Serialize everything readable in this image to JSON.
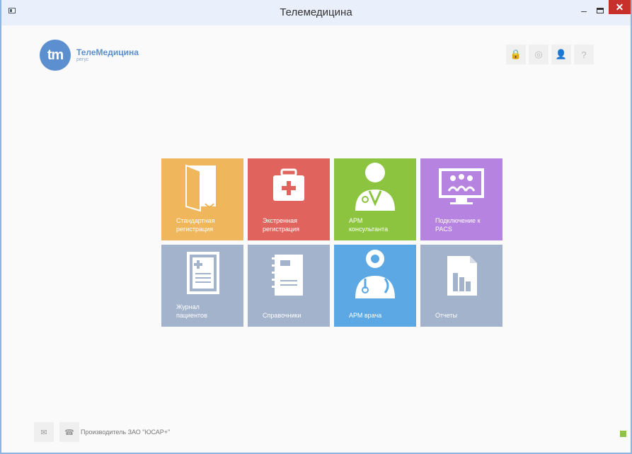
{
  "window": {
    "title": "Телемедицина",
    "controls": {
      "minimize": "–",
      "close": "✕"
    }
  },
  "logo": {
    "badge": "tm",
    "name": "ТелеМедицина",
    "subtitle": "регус"
  },
  "top_icons": [
    "lock-icon",
    "settings-icon",
    "user-icon",
    "help-icon"
  ],
  "top_icon_glyphs": {
    "lock": "🔒",
    "settings": "◎",
    "user": "👤",
    "help": "?"
  },
  "tiles": [
    {
      "label": "Стандартная\nрегистрация",
      "color": "#f0b65c",
      "icon": "folder-icon"
    },
    {
      "label": "Экстренная\nрегистрация",
      "color": "#e0635d",
      "icon": "medical-case-icon"
    },
    {
      "label": "АРМ\nконсультанта",
      "color": "#8cc43f",
      "icon": "consultant-icon"
    },
    {
      "label": "Подключение к\nPACS",
      "color": "#b684e0",
      "icon": "pacs-monitor-icon"
    },
    {
      "label": "Журнал\nпациентов",
      "color": "#a3b3cc",
      "icon": "journal-icon"
    },
    {
      "label": "Справочники",
      "color": "#a3b3cc",
      "icon": "handbook-icon"
    },
    {
      "label": "АРМ врача",
      "color": "#5ba8e4",
      "icon": "doctor-icon"
    },
    {
      "label": "Отчеты",
      "color": "#a3b3cc",
      "icon": "reports-icon"
    }
  ],
  "footer": {
    "mail_glyph": "✉",
    "phone_glyph": "☎",
    "maker": "Производитель ЗАО \"ЮСАР+\""
  }
}
